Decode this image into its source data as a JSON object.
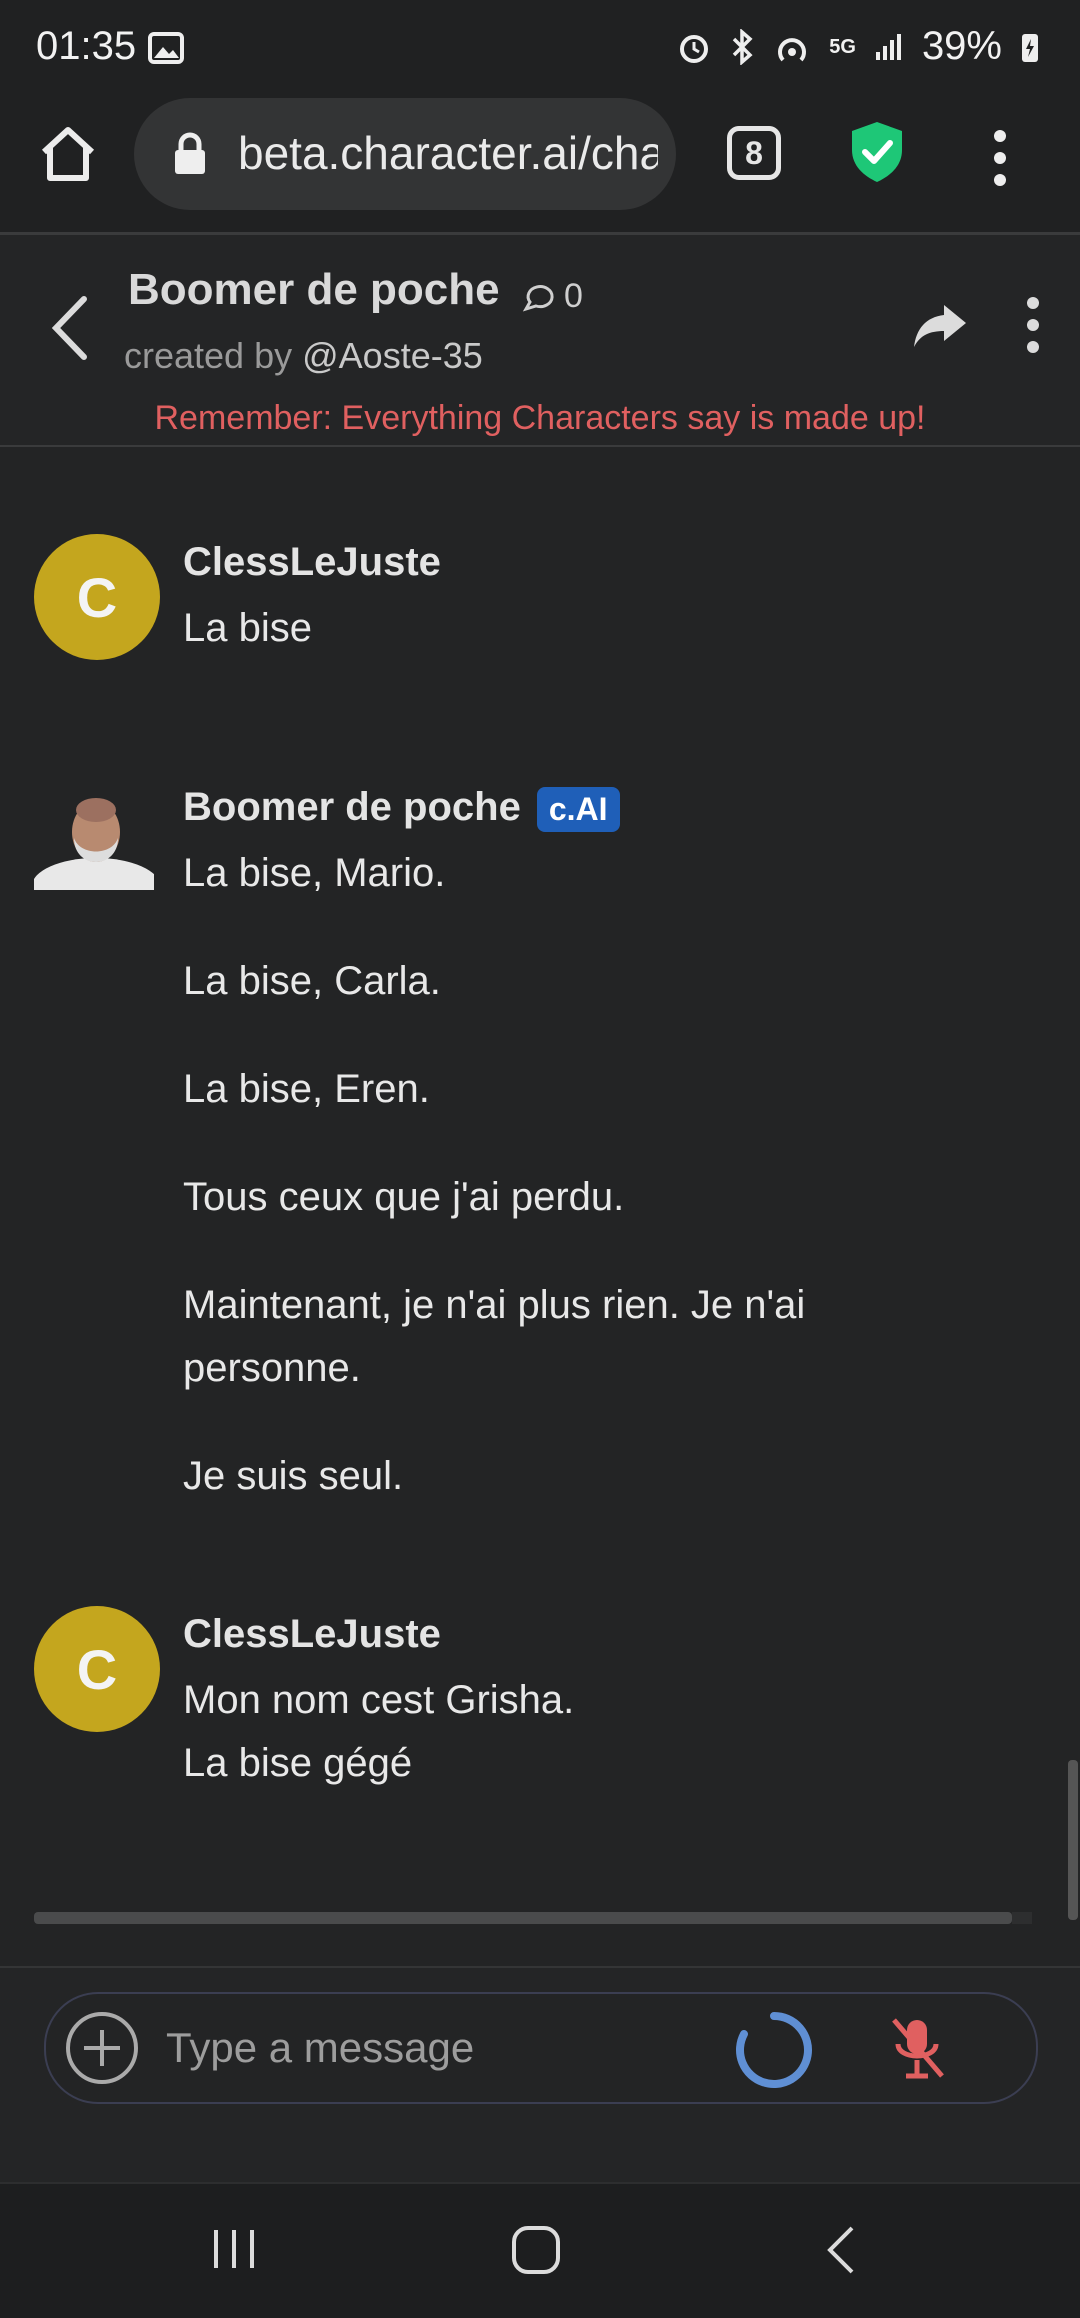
{
  "status_bar": {
    "time": "01:35",
    "network": "5G",
    "battery": "39%"
  },
  "browser": {
    "url": "beta.character.ai/chat",
    "tab_count": "8"
  },
  "header": {
    "character_name": "Boomer de poche",
    "chat_count": "0",
    "created_by_label": "created by",
    "creator": "@Aoste-35",
    "disclaimer": "Remember: Everything Characters say is made up!"
  },
  "messages": [
    {
      "author": "ClessLeJuste",
      "avatar_letter": "C",
      "lines": [
        "La bise"
      ]
    },
    {
      "author": "Boomer de poche",
      "badge": "c.AI",
      "paragraphs": [
        "La bise, Mario.",
        "La bise, Carla.",
        "La bise, Eren.",
        "Tous ceux que j'ai perdu.",
        "Maintenant, je n'ai plus rien. Je n'ai personne.",
        "Je suis seul."
      ]
    },
    {
      "author": "ClessLeJuste",
      "avatar_letter": "C",
      "lines": [
        "Mon nom cest Grisha.",
        "La bise gégé"
      ]
    }
  ],
  "composer": {
    "placeholder": "Type a message"
  },
  "colors": {
    "background": "#232425",
    "user_avatar": "#c4a61e",
    "badge": "#1f5fb8",
    "disclaimer": "#e06060",
    "shield": "#1ec777",
    "mic": "#e06060"
  }
}
